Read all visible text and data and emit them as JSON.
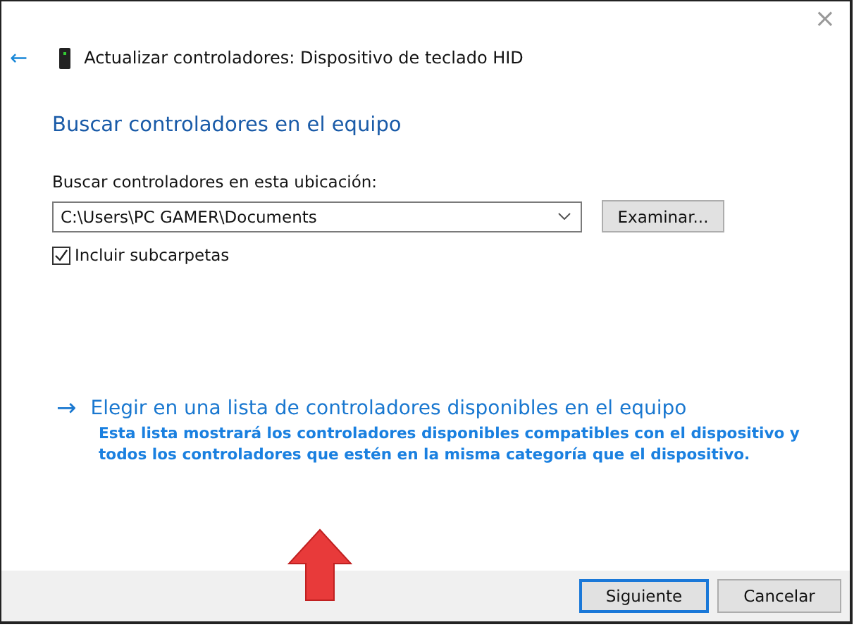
{
  "window": {
    "close": "×",
    "back": "←",
    "title": "Actualizar controladores: Dispositivo de teclado HID"
  },
  "heading": "Buscar controladores en el equipo",
  "location": {
    "label": "Buscar controladores en esta ubicación:",
    "value": "C:\\Users\\PC GAMER\\Documents",
    "browse": "Examinar..."
  },
  "include_subfolders": {
    "label": "Incluir subcarpetas",
    "checked": true
  },
  "option": {
    "arrow": "→",
    "title": "Elegir en una lista de controladores disponibles en el equipo",
    "description": "Esta lista mostrará los controladores disponibles compatibles con el dispositivo y todos los controladores que estén en la misma categoría que el dispositivo."
  },
  "buttons": [
    {
      "label": "Siguiente",
      "selected": true
    },
    {
      "label": "Cancelar",
      "selected": false
    }
  ]
}
